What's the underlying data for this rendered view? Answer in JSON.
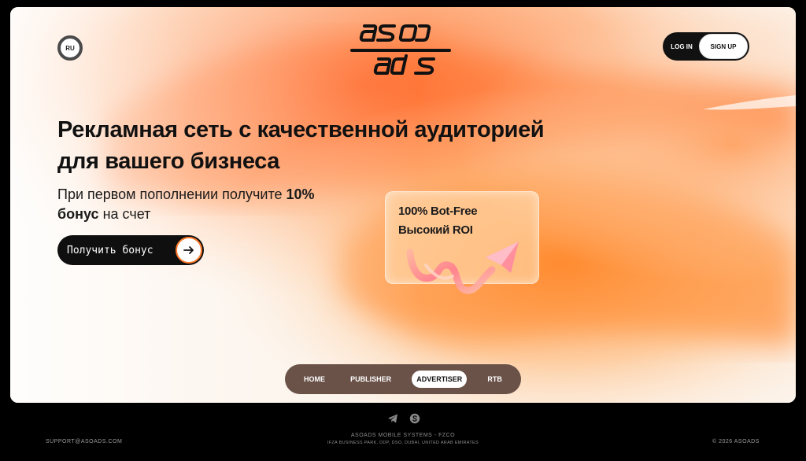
{
  "header": {
    "lang": "RU",
    "logo_alt": "aso ads",
    "login_label": "LOG IN",
    "signup_label": "SIGN UP"
  },
  "hero": {
    "title_line1": "Рекламная сеть с качественной аудиторией",
    "title_line2": "для вашего бизнеса",
    "sub_pre": "При первом пополнении получите ",
    "sub_bold1": "10%",
    "sub_bold2": "бонус",
    "sub_post": " на счет",
    "cta_label": "Получить бонус"
  },
  "feature": {
    "line1": "100% Bot-Free",
    "line2": "Высокий ROI"
  },
  "nav": {
    "items": [
      {
        "label": "HOME",
        "active": false
      },
      {
        "label": "PUBLISHER",
        "active": false
      },
      {
        "label": "ADVERTISER",
        "active": true
      },
      {
        "label": "RTB",
        "active": false
      }
    ]
  },
  "footer": {
    "email": "SUPPORT@ASOADS.COM",
    "company": "ASOADS MOBILE SYSTEMS - FZCO",
    "address": "IFZA BUSINESS PARK, DDP, DSO, DUBAI, UNITED ARAB EMIRATES",
    "copyright": "© 2026 ASOADS",
    "icons": [
      "telegram-icon",
      "skype-icon"
    ]
  },
  "colors": {
    "accent": "#ff7a2a",
    "dark": "#0f0f0f",
    "nav_bg": "#6a5249"
  }
}
